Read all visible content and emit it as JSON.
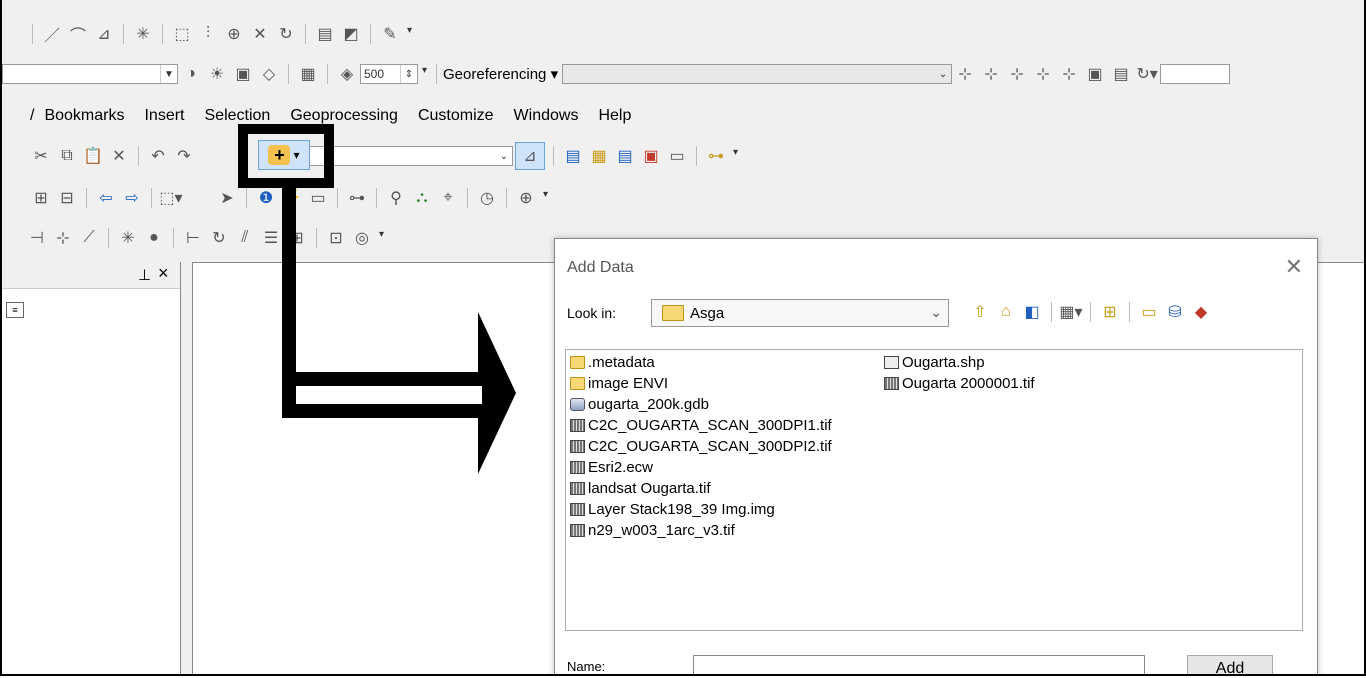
{
  "toolbar_row1": {
    "icons": [
      "line-tool-icon",
      "curve-tool-icon",
      "trace-tool-icon",
      "snap-icon",
      "extent-icon",
      "split-icon",
      "midpoint-icon",
      "cross-icon",
      "rotate-icon",
      "table-icon",
      "chart-icon",
      "editor-icon"
    ]
  },
  "toolbar_row2": {
    "scale_value": "500",
    "georeferencing_label": "Georeferencing ▾",
    "layer_combo_value": ""
  },
  "menu": {
    "items": [
      "/",
      "Bookmarks",
      "Insert",
      "Selection",
      "Geoprocessing",
      "Customize",
      "Windows",
      "Help"
    ]
  },
  "standard_toolbar": {
    "add_data_icon": "add-data-icon",
    "add_data_glyph": "+",
    "dropdown_glyph": "▾"
  },
  "toc_panel": {
    "pin": "ɨ",
    "close": "×"
  },
  "dialog": {
    "title": "Add Data",
    "close": "✕",
    "look_in_label": "Look in:",
    "look_in_value": "Asga",
    "name_label": "Name:",
    "name_value": "",
    "add_label": "Add",
    "files_col1": [
      {
        "name": ".metadata",
        "type": "folder"
      },
      {
        "name": "image ENVI",
        "type": "folder"
      },
      {
        "name": "ougarta_200k.gdb",
        "type": "gdb"
      },
      {
        "name": "C2C_OUGARTA_SCAN_300DPI1.tif",
        "type": "raster"
      },
      {
        "name": "C2C_OUGARTA_SCAN_300DPI2.tif",
        "type": "raster"
      },
      {
        "name": "Esri2.ecw",
        "type": "raster"
      },
      {
        "name": "landsat Ougarta.tif",
        "type": "raster"
      },
      {
        "name": "Layer Stack198_39 Img.img",
        "type": "raster"
      },
      {
        "name": "n29_w003_1arc_v3.tif",
        "type": "raster"
      }
    ],
    "files_col2": [
      {
        "name": "Ougarta.shp",
        "type": "shp"
      },
      {
        "name": "Ougarta 2000001.tif",
        "type": "raster"
      }
    ]
  }
}
